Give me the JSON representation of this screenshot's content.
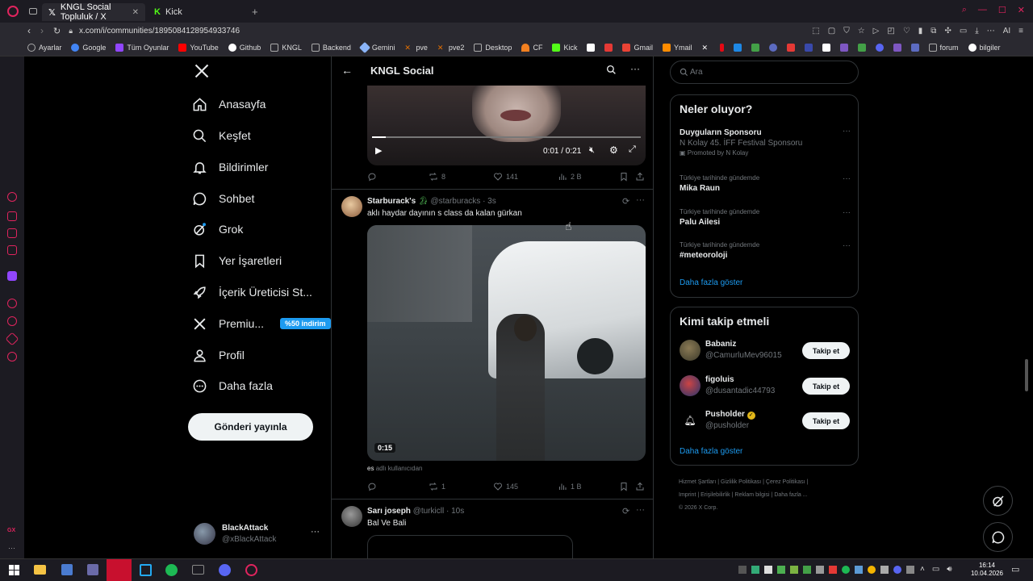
{
  "browser": {
    "tabs": [
      {
        "label": "KNGL Social Topluluk / X",
        "active": true
      },
      {
        "label": "Kick",
        "active": false
      }
    ],
    "url": "x.com/i/communities/1895084128954933746",
    "bookmarks": [
      "Ayarlar",
      "Google",
      "Tüm Oyunlar",
      "YouTube",
      "Github",
      "KNGL",
      "Backend",
      "Gemini",
      "pve",
      "pve2",
      "Desktop",
      "CF",
      "Kick",
      "Gmail",
      "Ymail",
      "forum",
      "bilgiler"
    ],
    "ai_label": "AI"
  },
  "nav": {
    "items": [
      {
        "label": "Anasayfa",
        "icon": "home-icon"
      },
      {
        "label": "Keşfet",
        "icon": "search-icon"
      },
      {
        "label": "Bildirimler",
        "icon": "bell-icon"
      },
      {
        "label": "Sohbet",
        "icon": "chat-icon"
      },
      {
        "label": "Grok",
        "icon": "grok-icon"
      },
      {
        "label": "Yer İşaretleri",
        "icon": "bookmark-icon"
      },
      {
        "label": "İçerik Üreticisi St...",
        "icon": "rocket-icon"
      },
      {
        "label": "Premiu...",
        "icon": "x-icon"
      },
      {
        "label": "Profil",
        "icon": "person-icon"
      },
      {
        "label": "Daha fazla",
        "icon": "more-circle-icon"
      }
    ],
    "premium_badge": "%50 indirim",
    "post_button": "Gönderi yayınla",
    "account": {
      "name": "BlackAttack",
      "handle": "@xBlackAttack"
    }
  },
  "community": {
    "title": "KNGL Social"
  },
  "video1": {
    "time": "0:01 / 0:21",
    "progress": 0.05,
    "replies": "",
    "reposts": "8",
    "likes": "141",
    "views": "2 B"
  },
  "post2": {
    "name": "Starburack's",
    "handle": "@starburacks",
    "time": "· 3s",
    "text": "aklı haydar dayının s class da kalan gürkan",
    "video_duration": "0:15",
    "caption_user": "es",
    "caption_suffix": "adlı kullanıcıdan",
    "reposts": "1",
    "likes": "145",
    "views": "1 B"
  },
  "post3": {
    "name": "Sarı joseph",
    "handle": "@turkicll",
    "time": "· 10s",
    "text": "Bal Ve Bali"
  },
  "search": {
    "placeholder": "Ara"
  },
  "trends": {
    "title": "Neler oluyor?",
    "items": [
      {
        "meta": "",
        "title": "Duyguların Sponsoru",
        "subtitle": "N Kolay 45. İFF Festival Sponsoru",
        "promoted": "Promoted by N Kolay"
      },
      {
        "meta": "Türkiye tarihinde gündemde",
        "title": "Mika Raun"
      },
      {
        "meta": "Türkiye tarihinde gündemde",
        "title": "Palu Ailesi"
      },
      {
        "meta": "Türkiye tarihinde gündemde",
        "title": "#meteoroloji"
      }
    ],
    "more": "Daha fazla göster"
  },
  "who_to_follow": {
    "title": "Kimi takip etmeli",
    "users": [
      {
        "name": "Babaniz",
        "handle": "@CamurluMev96015",
        "button": "Takip et"
      },
      {
        "name": "figoluis",
        "handle": "@dusantadic44793",
        "button": "Takip et"
      },
      {
        "name": "Pusholder",
        "handle": "@pusholder",
        "button": "Takip et"
      }
    ],
    "more": "Daha fazla göster"
  },
  "footer": {
    "links": [
      "Hizmet Şartları",
      "Gizlilik Politikası",
      "Çerez Politikası",
      "Imprint",
      "Erişilebilirlik",
      "Reklam bilgisi",
      "Daha fazla ..."
    ],
    "copyright": "© 2026 X Corp."
  },
  "taskbar": {
    "time": "16:14",
    "date": "10.04.2026"
  },
  "colors": {
    "accent": "#1d9bf0",
    "opera_red": "#e0245e",
    "bg": "#000000"
  }
}
